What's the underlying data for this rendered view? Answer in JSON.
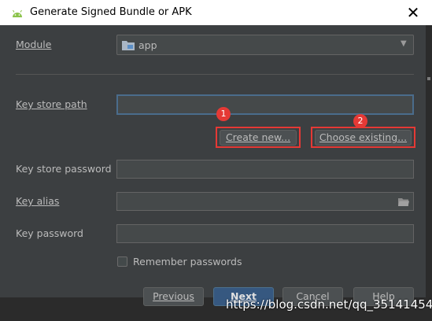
{
  "window": {
    "title": "Generate Signed Bundle or APK",
    "close_glyph": "✕"
  },
  "module": {
    "label": "Module",
    "value": "app"
  },
  "keystore": {
    "path_label": "Key store path",
    "path_value": "",
    "create_new": "Create new...",
    "choose_existing": "Choose existing...",
    "password_label": "Key store password",
    "alias_label": "Key alias",
    "key_password_label": "Key password",
    "remember_label": "Remember passwords"
  },
  "annotations": {
    "badge1": "1",
    "badge2": "2",
    "highlight_color": "#e53935"
  },
  "buttons": {
    "previous": "Previous",
    "next": "Next",
    "cancel": "Cancel",
    "help": "Help"
  },
  "watermark": "https://blog.csdn.net/qq_35141454",
  "colors": {
    "background": "#3c3f41",
    "field": "#45494a",
    "focus_border": "#4a6c8c",
    "default_button": "#365880"
  }
}
